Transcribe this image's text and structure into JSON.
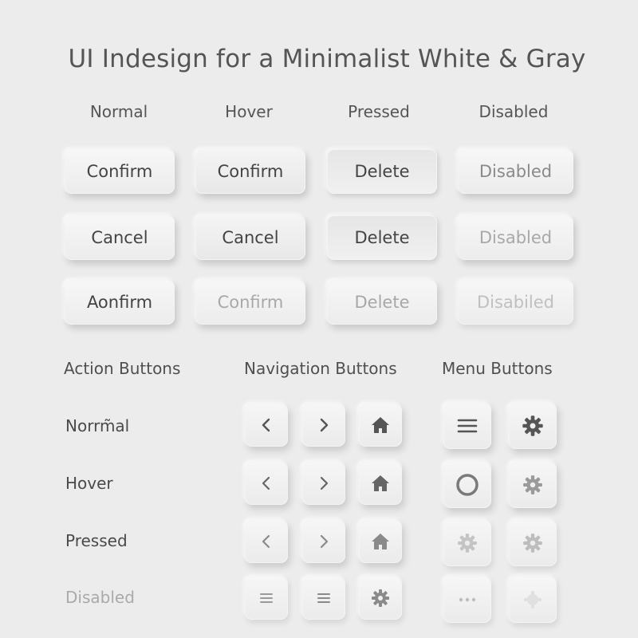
{
  "title": "UI Indesign for a Minimalist White & Gray",
  "states": [
    "Normal",
    "Hover",
    "Pressed",
    "Disabled"
  ],
  "button_grid": [
    [
      "Confirm",
      "Confirm",
      "Delete",
      "Disabled"
    ],
    [
      "Cancel",
      "Cancel",
      "Delete",
      "Disabled"
    ],
    [
      "Aonfirm",
      "Confirm",
      "Delete",
      "Disabiled"
    ]
  ],
  "sections": {
    "action": "Action Buttons",
    "navigation": "Navigation Buttons",
    "menu": "Menu Buttons"
  },
  "row_labels": [
    "Norrm̃al",
    "Hover",
    "Pressed",
    "Disabled"
  ],
  "icons": {
    "nav_rows": [
      [
        "chevron-left-icon",
        "chevron-right-icon",
        "home-icon"
      ],
      [
        "chevron-left-icon",
        "chevron-right-icon",
        "home-icon"
      ],
      [
        "chevron-left-icon",
        "chevron-right-icon",
        "home-icon"
      ],
      [
        "menu-icon",
        "menu-icon",
        "gear-icon"
      ]
    ],
    "menu_rows": [
      [
        "menu-icon",
        "gear-icon"
      ],
      [
        "circle-icon",
        "gear-icon"
      ],
      [
        "gear-icon",
        "gear-icon"
      ],
      [
        "more-icon",
        "gear-icon"
      ]
    ]
  },
  "colors": {
    "background": "#ececec",
    "button_face": "#f3f3f3",
    "text": "#444444",
    "disabled_text": "#aaaaaa"
  }
}
